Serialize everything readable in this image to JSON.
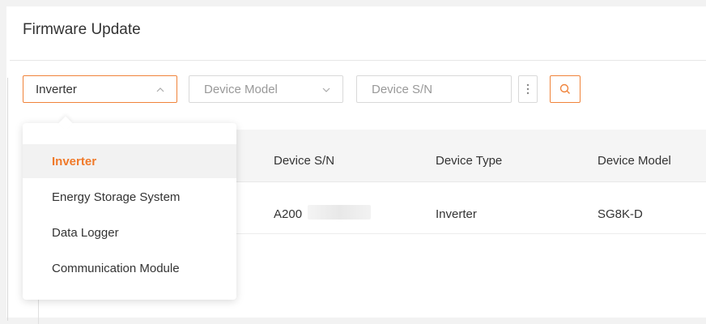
{
  "page": {
    "title": "Firmware Update"
  },
  "filters": {
    "device_type": {
      "value": "Inverter"
    },
    "device_model": {
      "placeholder": "Device Model"
    },
    "device_sn": {
      "placeholder": "Device S/N",
      "value": ""
    }
  },
  "dropdown": {
    "items": [
      {
        "label": "Inverter",
        "selected": true
      },
      {
        "label": "Energy Storage System",
        "selected": false
      },
      {
        "label": "Data Logger",
        "selected": false
      },
      {
        "label": "Communication Module",
        "selected": false
      }
    ]
  },
  "table": {
    "columns": [
      "Device S/N",
      "Device Type",
      "Device Model"
    ],
    "rows": [
      {
        "sn": "A200",
        "type": "Inverter",
        "model": "SG8K-D"
      }
    ]
  },
  "colors": {
    "accent": "#f0833a",
    "selected_text": "#f07a2a"
  },
  "icons": {
    "type_chevron": "chevron-up-icon",
    "model_chevron": "chevron-down-icon",
    "more": "more-vertical-icon",
    "search": "search-icon"
  }
}
